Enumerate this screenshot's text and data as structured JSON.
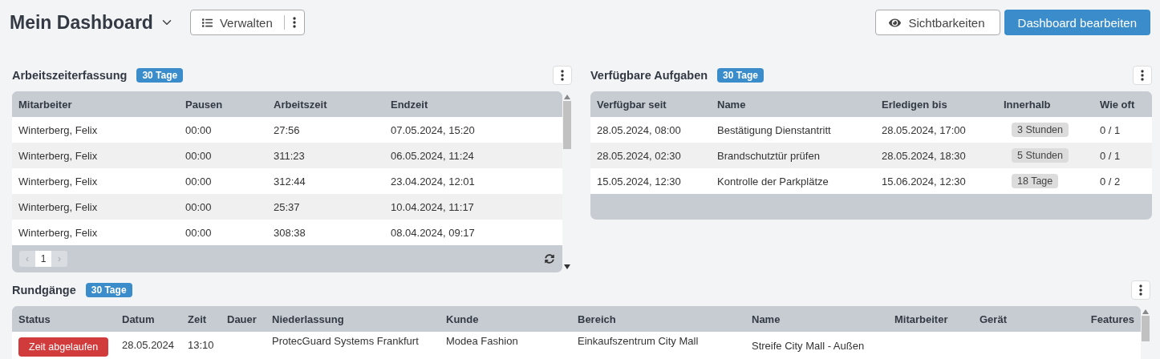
{
  "header": {
    "title": "Mein Dashboard",
    "manage_button": "Verwalten",
    "visibility_button": "Sichtbarkeiten",
    "edit_button": "Dashboard bearbeiten"
  },
  "widgets": [
    {
      "kind": "worktime",
      "title": "Arbeitszeiterfassung",
      "badge": "30 Tage",
      "columns": [
        "Mitarbeiter",
        "Pausen",
        "Arbeitszeit",
        "Endzeit"
      ],
      "rows": [
        [
          "Winterberg, Felix",
          "00:00",
          "27:56",
          "07.05.2024, 15:20"
        ],
        [
          "Winterberg, Felix",
          "00:00",
          "311:23",
          "06.05.2024, 11:24"
        ],
        [
          "Winterberg, Felix",
          "00:00",
          "312:44",
          "23.04.2024, 12:01"
        ],
        [
          "Winterberg, Felix",
          "00:00",
          "25:37",
          "10.04.2024, 11:17"
        ],
        [
          "Winterberg, Felix",
          "00:00",
          "308:38",
          "08.04.2024, 09:17"
        ]
      ],
      "pagination": {
        "prev": "‹",
        "next": "›",
        "pages": [
          {
            "label": "1",
            "selected": true
          }
        ]
      }
    },
    {
      "kind": "tasks",
      "title": "Verfügbare Aufgaben",
      "badge": "30 Tage",
      "columns": [
        "Verfügbar seit",
        "Name",
        "Erledigen bis",
        "Innerhalb",
        "Wie oft"
      ],
      "rows": [
        [
          "28.05.2024, 08:00",
          "Bestätigung Dienstantritt",
          "28.05.2024, 17:00",
          "3 Stunden",
          "0 / 1"
        ],
        [
          "28.05.2024, 02:30",
          "Brandschutztür prüfen",
          "28.05.2024, 18:30",
          "5 Stunden",
          "0 / 1"
        ],
        [
          "15.05.2024, 12:30",
          "Kontrolle der Parkplätze",
          "15.06.2024, 12:30",
          "18 Tage",
          "0 / 2"
        ]
      ]
    },
    {
      "kind": "rounds",
      "title": "Rundgänge",
      "badge": "30 Tage",
      "columns": [
        "Status",
        "Datum",
        "Zeit",
        "Dauer",
        "Niederlassung",
        "Kunde",
        "Bereich",
        "Name",
        "Mitarbeiter",
        "Gerät",
        "Features"
      ],
      "rows": [
        [
          "Zeit abgelaufen",
          "28.05.2024",
          "13:10",
          "",
          "ProtecGuard Systems Frankfurt",
          "Modea Fashion",
          "Einkaufszentrum City Mall",
          "Streife City Mall - Außen",
          "",
          "",
          ""
        ]
      ]
    }
  ]
}
